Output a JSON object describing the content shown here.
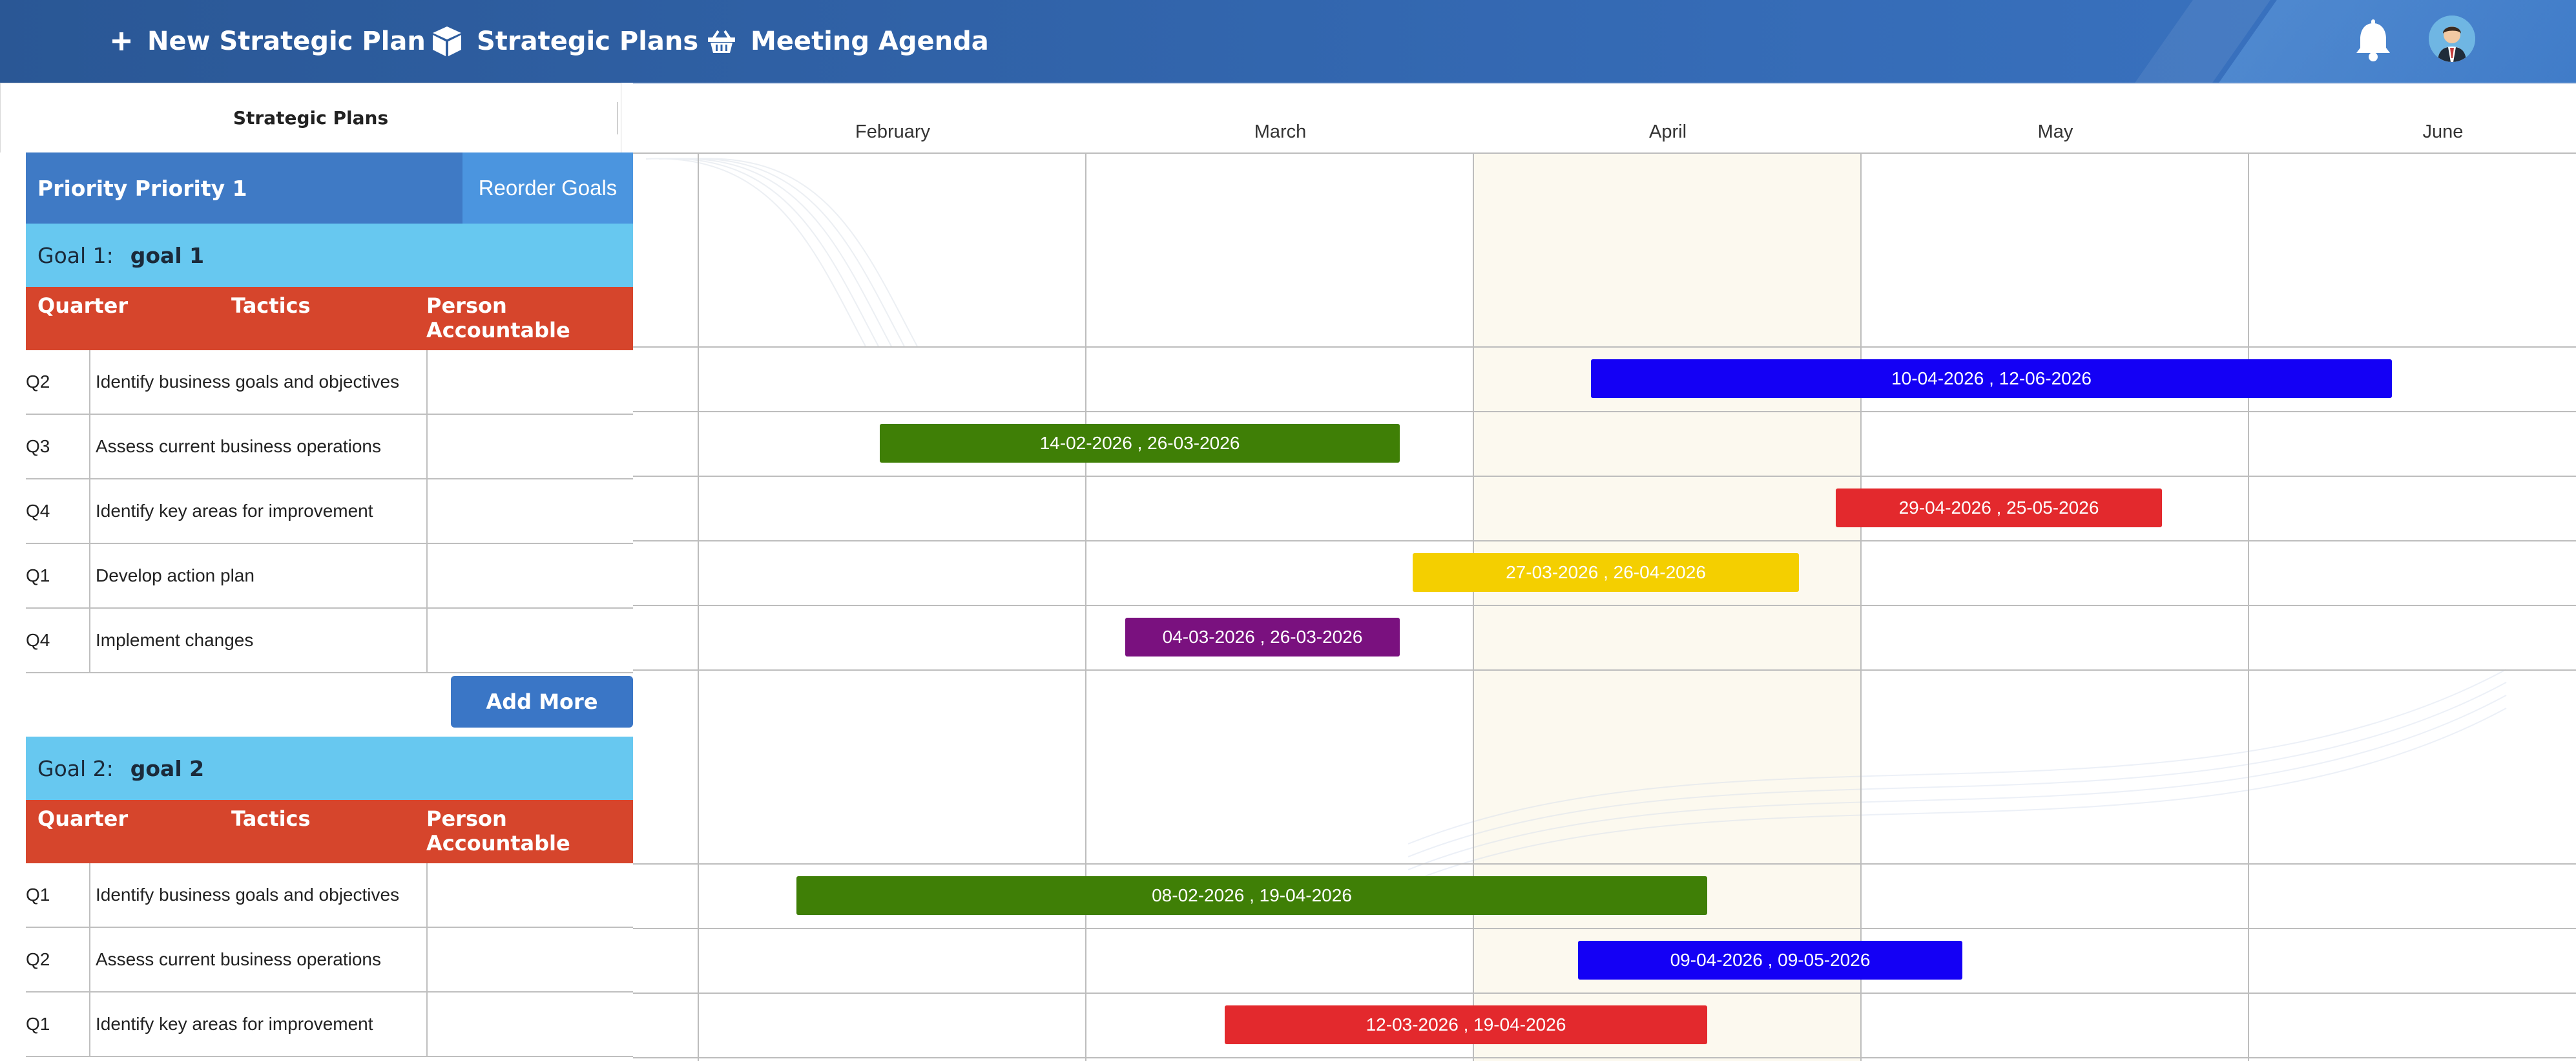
{
  "nav": {
    "new_plan": "New Strategic Plan",
    "strategic_plans": "Strategic Plans",
    "meeting_agenda": "Meeting Agenda"
  },
  "subheader": {
    "tab_label": "Strategic Plans"
  },
  "months": [
    "February",
    "March",
    "April",
    "May",
    "June"
  ],
  "priority": {
    "title": "Priority Priority 1",
    "reorder_label": "Reorder Goals"
  },
  "table_headers": {
    "quarter": "Quarter",
    "tactics": "Tactics",
    "person": "Person Accountable"
  },
  "goals": [
    {
      "prefix": "Goal 1:",
      "name": "goal 1",
      "rows": [
        {
          "quarter": "Q2",
          "tactic": "Identify business goals and objectives",
          "bar_label": "10-04-2026 , 12-06-2026",
          "color": "#1400f5"
        },
        {
          "quarter": "Q3",
          "tactic": "Assess current business operations",
          "bar_label": "14-02-2026 , 26-03-2026",
          "color": "#3f7f06"
        },
        {
          "quarter": "Q4",
          "tactic": "Identify key areas for improvement",
          "bar_label": "29-04-2026 , 25-05-2026",
          "color": "#e3292d"
        },
        {
          "quarter": "Q1",
          "tactic": "Develop action plan",
          "bar_label": "27-03-2026 , 26-04-2026",
          "color": "#f4cf00"
        },
        {
          "quarter": "Q4",
          "tactic": "Implement changes",
          "bar_label": "04-03-2026 , 26-03-2026",
          "color": "#7a117f"
        }
      ]
    },
    {
      "prefix": "Goal 2:",
      "name": "goal 2",
      "rows": [
        {
          "quarter": "Q1",
          "tactic": "Identify business goals and objectives",
          "bar_label": "08-02-2026 , 19-04-2026",
          "color": "#3f7f06"
        },
        {
          "quarter": "Q2",
          "tactic": "Assess current business operations",
          "bar_label": "09-04-2026 , 09-05-2026",
          "color": "#1400f5"
        },
        {
          "quarter": "Q1",
          "tactic": "Identify key areas for improvement",
          "bar_label": "12-03-2026 , 19-04-2026",
          "color": "#e3292d"
        }
      ]
    }
  ],
  "add_more_label": "Add More"
}
